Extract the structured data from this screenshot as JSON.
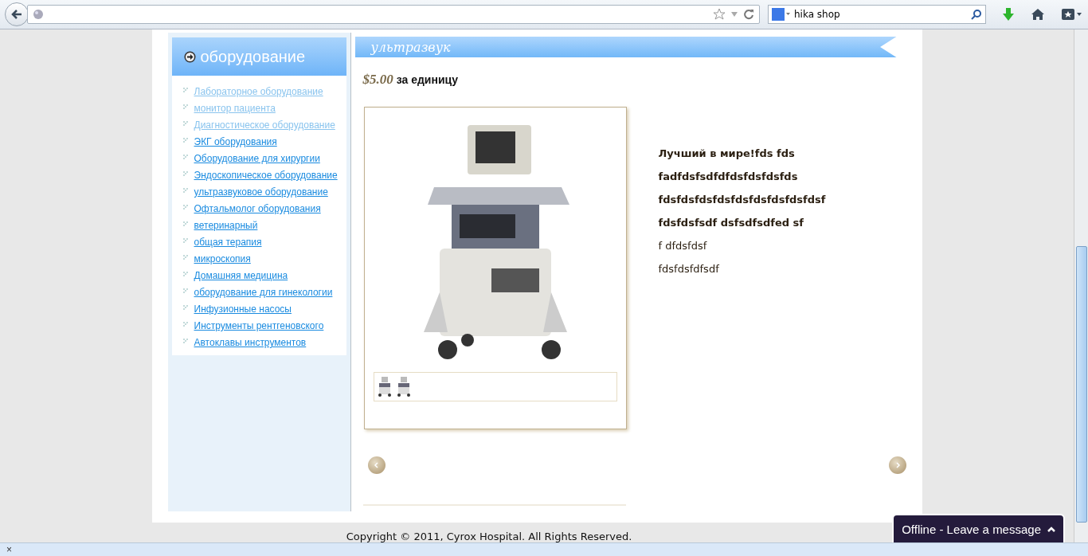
{
  "browser": {
    "search": {
      "value": "hika shop"
    }
  },
  "sidebar": {
    "title": "оборудование",
    "items": [
      {
        "label": "Лабораторное оборудование",
        "visited": true
      },
      {
        "label": "монитор пациента",
        "visited": true
      },
      {
        "label": "Диагностическое оборудование",
        "visited": true
      },
      {
        "label": "ЭКГ оборудования",
        "visited": false
      },
      {
        "label": "Оборудование для хирургии",
        "visited": false
      },
      {
        "label": "Эндоскопическое оборудование",
        "visited": false
      },
      {
        "label": "ультразвуковое оборудование",
        "visited": false
      },
      {
        "label": "Офтальмолог оборудования",
        "visited": false
      },
      {
        "label": "ветеринарный",
        "visited": false
      },
      {
        "label": "общая терапия",
        "visited": false
      },
      {
        "label": "микроскопия",
        "visited": false
      },
      {
        "label": "Домашняя медицина",
        "visited": false
      },
      {
        "label": "оборудование для гинекологии",
        "visited": false
      },
      {
        "label": "Инфузионные насосы",
        "visited": false
      },
      {
        "label": "Инструменты рентгеновского",
        "visited": false
      },
      {
        "label": "Автоклавы инструментов",
        "visited": false
      }
    ]
  },
  "product": {
    "title": "ультразвук",
    "price": "$5.00",
    "unit": "за единицу",
    "description": [
      {
        "text": "Лучший в мире!fds fds",
        "bold": true
      },
      {
        "text": "fadfdsfsdfdfdsfdsfdsfds",
        "bold": true
      },
      {
        "text": "fdsfdsfdsfdsfdsfdsfdsfdsfdsf",
        "bold": true
      },
      {
        "text": "fdsfdsfsdf dsfsdfsdfed sf",
        "bold": true
      },
      {
        "text": "f dfdsfdsf",
        "bold": false
      },
      {
        "text": "fdsfdsfdfsdf",
        "bold": false
      }
    ]
  },
  "footer": {
    "copyright": "Copyright © 2011, Cyrox Hospital. All Rights Reserved."
  },
  "chat": {
    "label": "Offline - Leave a message"
  },
  "status_bar": {
    "close": "×"
  }
}
